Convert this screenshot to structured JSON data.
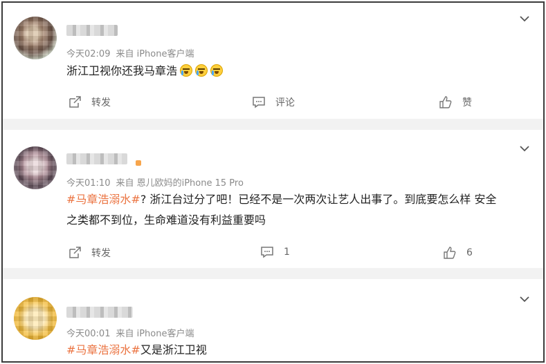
{
  "posts": [
    {
      "time": "今天02:09",
      "source": "来自 iPhone客户端",
      "text": "浙江卫视你还我马章浩",
      "emojis": [
        "crying-emoji",
        "crying-emoji",
        "crying-emoji"
      ],
      "actions": {
        "repost": "转发",
        "comment": "评论",
        "like": "赞"
      }
    },
    {
      "time": "今天01:10",
      "source": "来自 恩儿欧妈的iPhone 15 Pro",
      "topic": "#马章浩溺水#",
      "text_line1": "? 浙江台过分了吧！已经不是一次两次让艺人出事了。到底要怎么样 安全",
      "text_line2": "之类都不到位，生命难道没有利益重要吗",
      "actions": {
        "repost": "转发",
        "comment": "1",
        "like": "6"
      }
    },
    {
      "time": "今天00:01",
      "source": "来自 iPhone客户端",
      "topic": "#马章浩溺水#",
      "text": "又是浙江卫视"
    }
  ],
  "colors": {
    "topic": "#eb7340",
    "separator": "#f2f2f2",
    "meta": "#8a8a8a"
  }
}
